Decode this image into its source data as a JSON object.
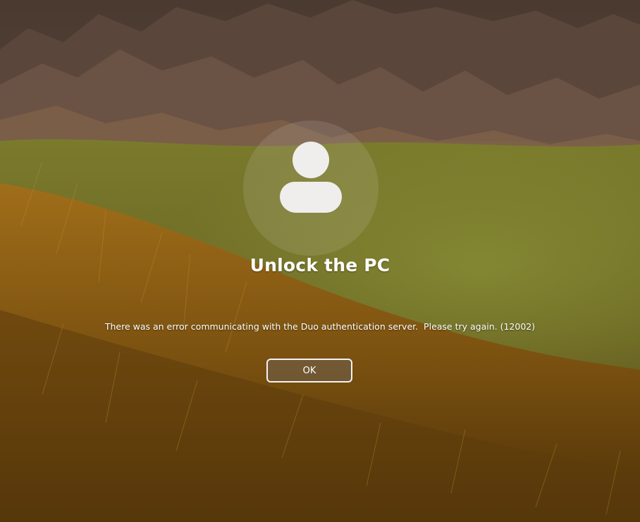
{
  "lock_screen": {
    "title": "Unlock the PC",
    "message": "There was an error communicating with the Duo authentication server.  Please try again. (12002)",
    "ok_button_label": "OK"
  },
  "icons": {
    "avatar": "user-avatar-icon"
  },
  "colors": {
    "text": "#ffffff",
    "avatar_fill": "#efeeec",
    "button_border": "#f2f2f2"
  }
}
